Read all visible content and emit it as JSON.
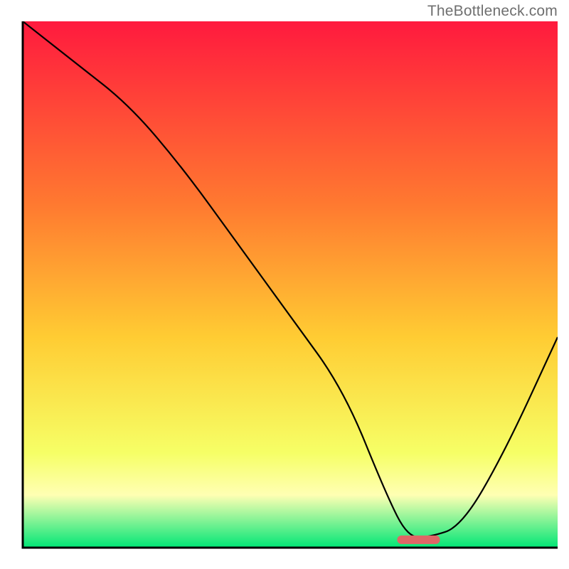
{
  "watermark": "TheBottleneck.com",
  "chart_data": {
    "type": "line",
    "title": "",
    "xlabel": "",
    "ylabel": "",
    "xlim": [
      0,
      100
    ],
    "ylim": [
      0,
      100
    ],
    "x": [
      0,
      10,
      20,
      30,
      40,
      50,
      60,
      68,
      72,
      76,
      82,
      90,
      100
    ],
    "values": [
      100,
      92,
      84,
      72,
      58,
      44,
      30,
      10,
      2,
      2,
      4,
      18,
      40
    ],
    "series": [
      {
        "name": "curve",
        "x": [
          0,
          10,
          20,
          30,
          40,
          50,
          60,
          68,
          72,
          76,
          82,
          90,
          100
        ],
        "values": [
          100,
          92,
          84,
          72,
          58,
          44,
          30,
          10,
          2,
          2,
          4,
          18,
          40
        ]
      }
    ],
    "marker": {
      "x_start": 70,
      "x_end": 78,
      "y": 1.5
    },
    "gradient": {
      "top": "#ff1a3e",
      "upper_mid": "#ff7a30",
      "mid": "#ffcc33",
      "lower_mid": "#f6ff66",
      "bottom_band_top": "#ffffb3",
      "bottom_band_bottom": "#00e676"
    },
    "axis_color": "#000000",
    "curve_color": "#000000",
    "marker_color": "#e06666"
  }
}
